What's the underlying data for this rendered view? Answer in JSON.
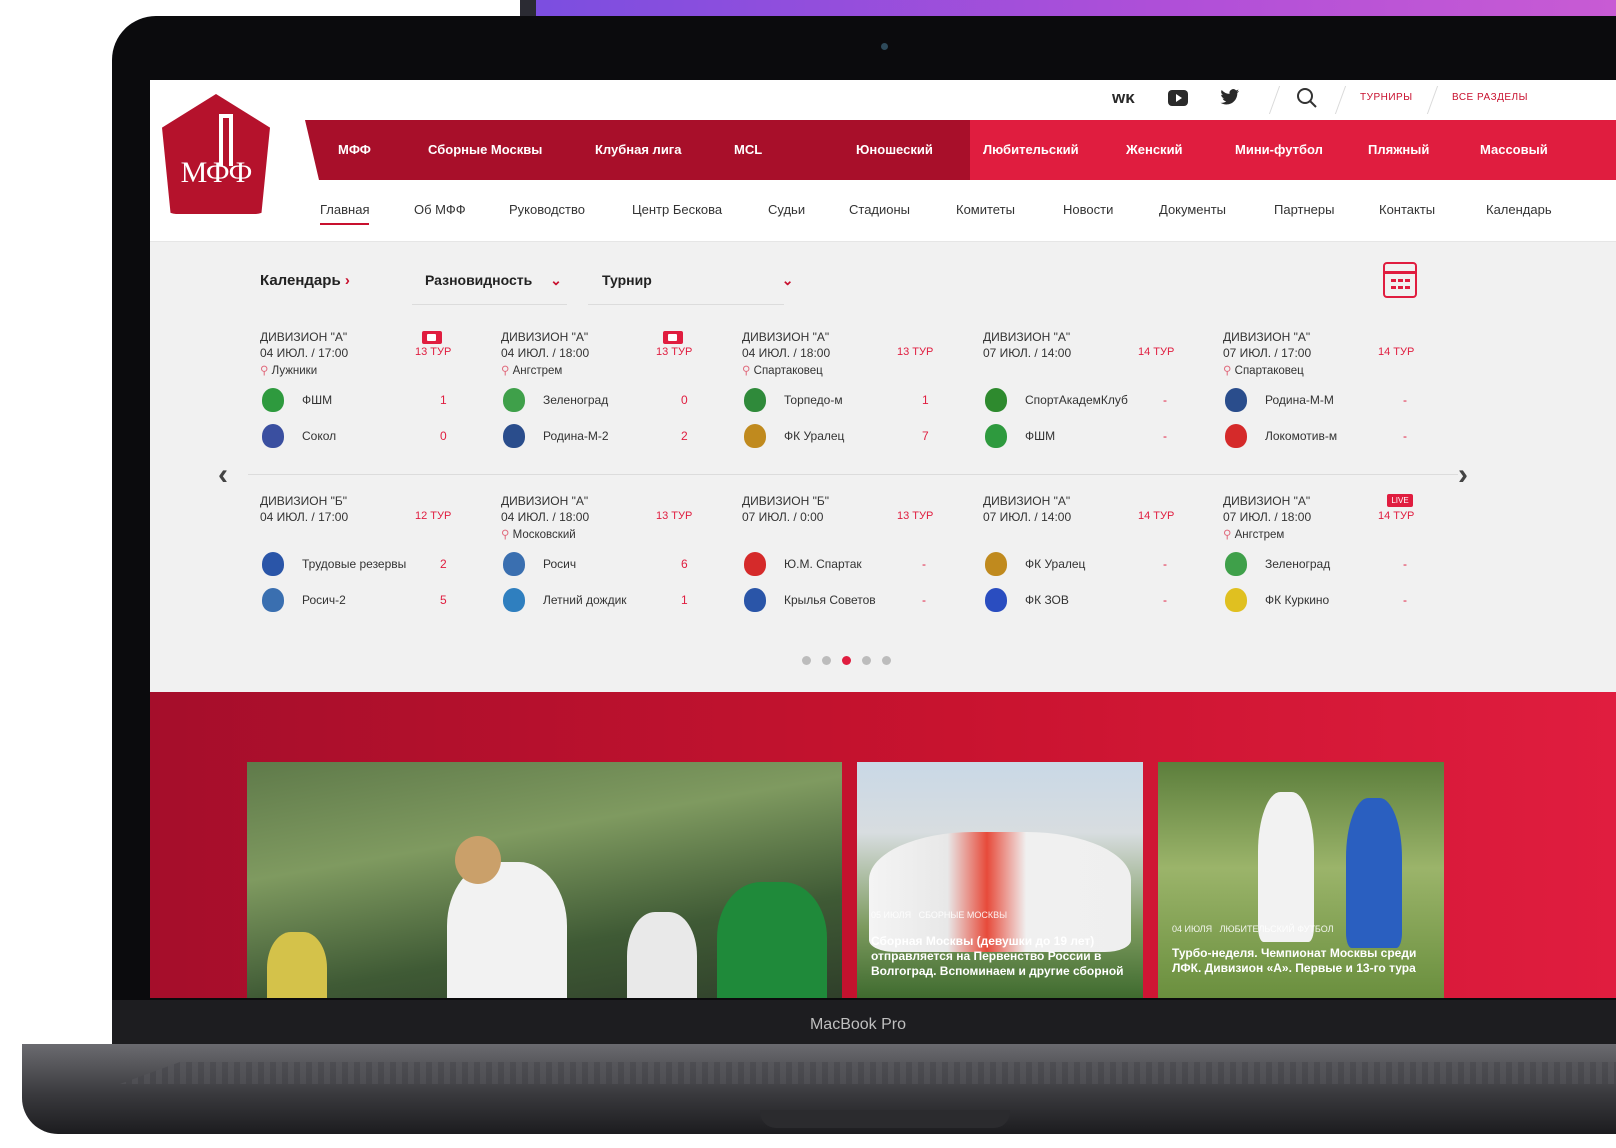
{
  "device": {
    "model_label": "MacBook Pro"
  },
  "topbar": {
    "social": [
      "ВК",
      "▶",
      "🐦"
    ],
    "search_icon": "search-icon",
    "links": [
      "ТУРНИРЫ",
      "ВСЕ РАЗДЕЛЫ"
    ]
  },
  "logo": {
    "text": "МФФ"
  },
  "main_nav": {
    "dark_items": [
      "МФФ",
      "Сборные Москвы",
      "Клубная лига",
      "MCL"
    ],
    "red_items": [
      "Юношеский",
      "Любительский",
      "Женский",
      "Мини-футбол",
      "Пляжный",
      "Массовый"
    ]
  },
  "sub_nav": {
    "items": [
      "Главная",
      "Об МФФ",
      "Руководство",
      "Центр Бескова",
      "Судьи",
      "Стадионы",
      "Комитеты",
      "Новости",
      "Документы",
      "Партнеры",
      "Контакты",
      "Календарь"
    ],
    "active_index": 0
  },
  "calendar": {
    "title": "Календарь",
    "filter_kind": "Разновидность",
    "filter_tournament": "Турнир",
    "matches_row1": [
      {
        "division": "ДИВИЗИОН \"А\"",
        "time": "04 ИЮЛ. / 17:00",
        "venue": "Лужники",
        "tour": "13 ТУР",
        "video": true,
        "live": false,
        "home": {
          "name": "ФШМ",
          "score": "1",
          "color": "#2e9a3e"
        },
        "away": {
          "name": "Сокол",
          "score": "0",
          "color": "#3a4fa0"
        }
      },
      {
        "division": "ДИВИЗИОН \"А\"",
        "time": "04 ИЮЛ. / 18:00",
        "venue": "Ангстрем",
        "tour": "13 ТУР",
        "video": true,
        "live": false,
        "home": {
          "name": "Зеленоград",
          "score": "0",
          "color": "#3fa04a"
        },
        "away": {
          "name": "Родина-М-2",
          "score": "2",
          "color": "#2a4d8c"
        }
      },
      {
        "division": "ДИВИЗИОН \"А\"",
        "time": "04 ИЮЛ. / 18:00",
        "venue": "Спартаковец",
        "tour": "13 ТУР",
        "video": false,
        "live": false,
        "home": {
          "name": "Торпедо-м",
          "score": "1",
          "color": "#2f8a3a"
        },
        "away": {
          "name": "ФК Уралец",
          "score": "7",
          "color": "#c08a1e"
        }
      },
      {
        "division": "ДИВИЗИОН \"А\"",
        "time": "07 ИЮЛ. / 14:00",
        "venue": "",
        "tour": "14 ТУР",
        "video": false,
        "live": false,
        "home": {
          "name": "СпортАкадемКлуб",
          "score": "-",
          "color": "#2e8a2e"
        },
        "away": {
          "name": "ФШМ",
          "score": "-",
          "color": "#2e9a3e"
        }
      },
      {
        "division": "ДИВИЗИОН \"А\"",
        "time": "07 ИЮЛ. / 17:00",
        "venue": "Спартаковец",
        "tour": "14 ТУР",
        "video": false,
        "live": false,
        "home": {
          "name": "Родина-М-М",
          "score": "-",
          "color": "#2a4d8c"
        },
        "away": {
          "name": "Локомотив-м",
          "score": "-",
          "color": "#d52a2a"
        }
      }
    ],
    "matches_row2": [
      {
        "division": "ДИВИЗИОН \"Б\"",
        "time": "04 ИЮЛ. / 17:00",
        "venue": "",
        "tour": "12 ТУР",
        "video": false,
        "live": false,
        "home": {
          "name": "Трудовые резервы",
          "score": "2",
          "color": "#2a55a8"
        },
        "away": {
          "name": "Росич-2",
          "score": "5",
          "color": "#3a6fb0"
        }
      },
      {
        "division": "ДИВИЗИОН \"А\"",
        "time": "04 ИЮЛ. / 18:00",
        "venue": "Московский",
        "tour": "13 ТУР",
        "video": false,
        "live": false,
        "home": {
          "name": "Росич",
          "score": "6",
          "color": "#3a6fb0"
        },
        "away": {
          "name": "Летний дождик",
          "score": "1",
          "color": "#2f7fbf"
        }
      },
      {
        "division": "ДИВИЗИОН \"Б\"",
        "time": "07 ИЮЛ. / 0:00",
        "venue": "",
        "tour": "13 ТУР",
        "video": false,
        "live": false,
        "home": {
          "name": "Ю.М. Спартак",
          "score": "-",
          "color": "#d52a2a"
        },
        "away": {
          "name": "Крылья Советов",
          "score": "-",
          "color": "#2a55a8"
        }
      },
      {
        "division": "ДИВИЗИОН \"А\"",
        "time": "07 ИЮЛ. / 14:00",
        "venue": "",
        "tour": "14 ТУР",
        "video": false,
        "live": false,
        "home": {
          "name": "ФК Уралец",
          "score": "-",
          "color": "#c08a1e"
        },
        "away": {
          "name": "ФК ЗОВ",
          "score": "-",
          "color": "#2a4dc0"
        }
      },
      {
        "division": "ДИВИЗИОН \"А\"",
        "time": "07 ИЮЛ. / 18:00",
        "venue": "Ангстрем",
        "tour": "14 ТУР",
        "video": false,
        "live": true,
        "live_label": "LIVE",
        "home": {
          "name": "Зеленоград",
          "score": "-",
          "color": "#3fa04a"
        },
        "away": {
          "name": "ФК Куркино",
          "score": "-",
          "color": "#e0c020"
        }
      }
    ],
    "pagination": {
      "count": 5,
      "active": 2
    }
  },
  "news": [
    {
      "date": "",
      "category": "",
      "title": ""
    },
    {
      "date": "05 июля",
      "category": "СБОРНЫЕ МОСКВЫ",
      "title": "Сборная Москвы (девушки до 19 лет) отправляется на Первенство России в Волгоград. Вспоминаем и другие сборной"
    },
    {
      "date": "04 июля",
      "category": "ЛЮБИТЕЛЬСКИЙ ФУТБОЛ",
      "title": "Турбо-неделя. Чемпионат Москвы среди ЛФК. Дивизион «А». Первые и 13-го тура"
    }
  ],
  "colors": {
    "brand_dark": "#a80f2a",
    "brand_red": "#e01d3f",
    "accent": "#c8102e"
  }
}
